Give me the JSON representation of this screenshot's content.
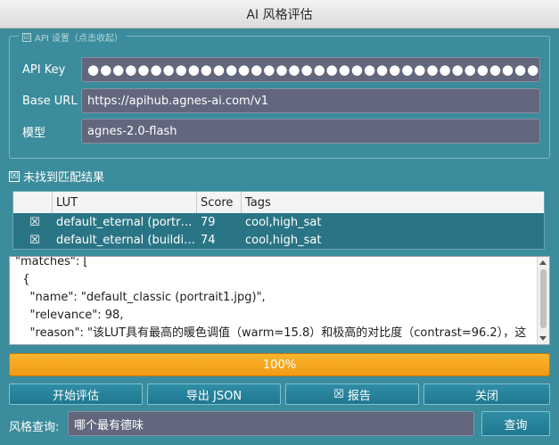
{
  "window": {
    "title": "AI 风格评估"
  },
  "api_group": {
    "title": "API 设置（点击收起）",
    "checked_glyph": "☑",
    "api_key": {
      "label": "API Key",
      "value": "●●●●●●●●●●●●●●●●●●●●●●●●●●●●●●●●●●●●●●●●●●"
    },
    "base_url": {
      "label": "Base URL",
      "value": "https://apihub.agnes-ai.com/v1"
    },
    "model": {
      "label": "模型",
      "value": "agnes-2.0-flash"
    }
  },
  "status": {
    "checkbox_glyph": "☒",
    "text": "未找到匹配结果"
  },
  "table": {
    "headers": [
      "",
      "LUT",
      "Score",
      "Tags"
    ],
    "rows": [
      {
        "check": "☒",
        "lut": "default_eternal (portr…",
        "score": "79",
        "tags": "cool,high_sat"
      },
      {
        "check": "☒",
        "lut": "default_eternal (buildi…",
        "score": "74",
        "tags": "cool,high_sat"
      }
    ]
  },
  "output": {
    "lines": [
      "\"matches\": [",
      "  {",
      "    \"name\": \"default_classic (portrait1.jpg)\",",
      "    \"relevance\": 98,",
      "    \"reason\": \"该LUT具有最高的暖色调值（warm=15.8）和极高的对比度（contrast=96.2），这"
    ]
  },
  "progress": {
    "value": 1.0,
    "label": "100%"
  },
  "buttons": {
    "start": "开始评估",
    "export": "导出 JSON",
    "report_icon": "☒",
    "report": "报告",
    "close": "关闭"
  },
  "query": {
    "label": "风格查询:",
    "value": "哪个最有德味",
    "button": "查询"
  },
  "colors": {
    "background": "#3b8c9c",
    "progress": "#f29a14",
    "input_bg": "#62677e"
  }
}
